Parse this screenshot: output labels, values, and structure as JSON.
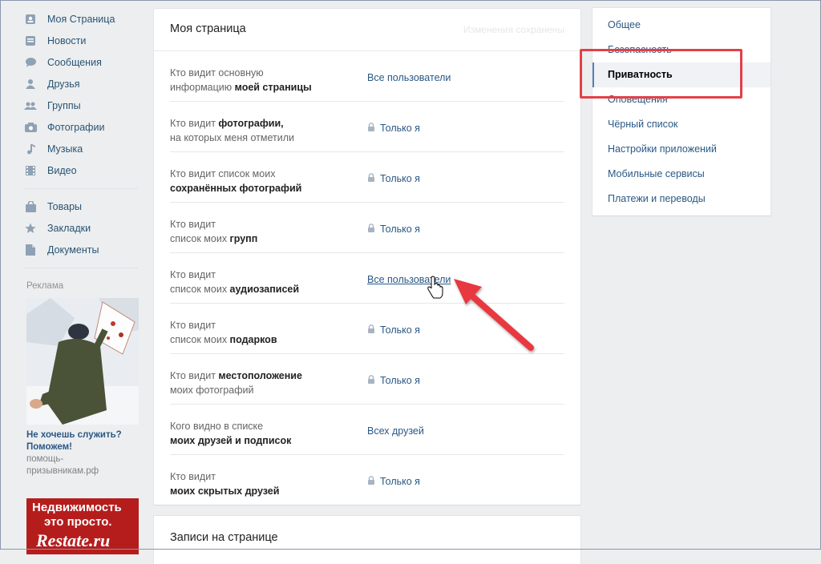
{
  "sidebar": {
    "items": [
      {
        "label": "Моя Страница",
        "icon": "home-icon"
      },
      {
        "label": "Новости",
        "icon": "news-icon"
      },
      {
        "label": "Сообщения",
        "icon": "messages-icon"
      },
      {
        "label": "Друзья",
        "icon": "friends-icon"
      },
      {
        "label": "Группы",
        "icon": "groups-icon"
      },
      {
        "label": "Фотографии",
        "icon": "camera-icon"
      },
      {
        "label": "Музыка",
        "icon": "music-icon"
      },
      {
        "label": "Видео",
        "icon": "video-icon"
      }
    ],
    "items2": [
      {
        "label": "Товары",
        "icon": "bag-icon"
      },
      {
        "label": "Закладки",
        "icon": "star-icon"
      },
      {
        "label": "Документы",
        "icon": "document-icon"
      }
    ],
    "ad": {
      "title": "Реклама",
      "headline": "Не хочешь служить? Поможем!",
      "domain": "помощь-призывникам.рф",
      "banner_line1": "Недвижимость",
      "banner_line2": "это просто.",
      "banner_brand": "Restate.ru"
    }
  },
  "main": {
    "title": "Моя страница",
    "saved_note": "Изменения сохранены",
    "rows": [
      {
        "l1": "Кто видит основную",
        "l2_plain": "информацию ",
        "l2_bold": "моей страницы",
        "value": "Все пользователи",
        "lock": false
      },
      {
        "l1_plain": "Кто видит ",
        "l1_bold": "фотографии,",
        "l2_plain": "на которых меня отметили",
        "value": "Только я",
        "lock": true
      },
      {
        "l1": "Кто видит список моих",
        "l2_bold": "сохранённых фотографий",
        "value": "Только я",
        "lock": true
      },
      {
        "l1": "Кто видит",
        "l2_plain": "список моих ",
        "l2_bold": "групп",
        "value": "Только я",
        "lock": true
      },
      {
        "l1": "Кто видит",
        "l2_plain": "список моих ",
        "l2_bold": "аудиозаписей",
        "value": "Все пользователи",
        "lock": false
      },
      {
        "l1": "Кто видит",
        "l2_plain": "список моих ",
        "l2_bold": "подарков",
        "value": "Только я",
        "lock": true
      },
      {
        "l1_plain": "Кто видит ",
        "l1_bold": "местоположение",
        "l2_plain": "моих фотографий",
        "value": "Только я",
        "lock": true
      },
      {
        "l1": "Кого видно в списке",
        "l2_bold": "моих друзей и подписок",
        "value": "Всех друзей",
        "lock": false
      },
      {
        "l1": "Кто видит",
        "l2_bold": "моих скрытых друзей",
        "value": "Только я",
        "lock": true
      }
    ],
    "section2_title": "Записи на странице"
  },
  "rmenu": {
    "items": [
      "Общее",
      "Безопасность",
      "Приватность",
      "Оповещения",
      "Чёрный список",
      "Настройки приложений",
      "Мобильные сервисы",
      "Платежи и переводы"
    ],
    "active": "Приватность"
  },
  "colors": {
    "link": "#2a5885",
    "accent": "#5181b8",
    "highlight": "#e24047",
    "arrow": "#e8393f"
  }
}
